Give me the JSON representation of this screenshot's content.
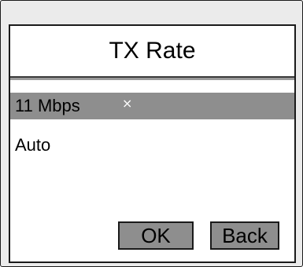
{
  "dialog": {
    "title": "TX Rate"
  },
  "options": [
    {
      "label": "11 Mbps",
      "selected": true,
      "marker": "×"
    },
    {
      "label": "Auto",
      "selected": false
    }
  ],
  "buttons": {
    "ok_label": "OK",
    "back_label": "Back"
  },
  "colors": {
    "frame": "#ebebeb",
    "panel": "#ffffff",
    "selection": "#8e8e8e",
    "button": "#8e8e8e",
    "border": "#1a1a1a"
  }
}
